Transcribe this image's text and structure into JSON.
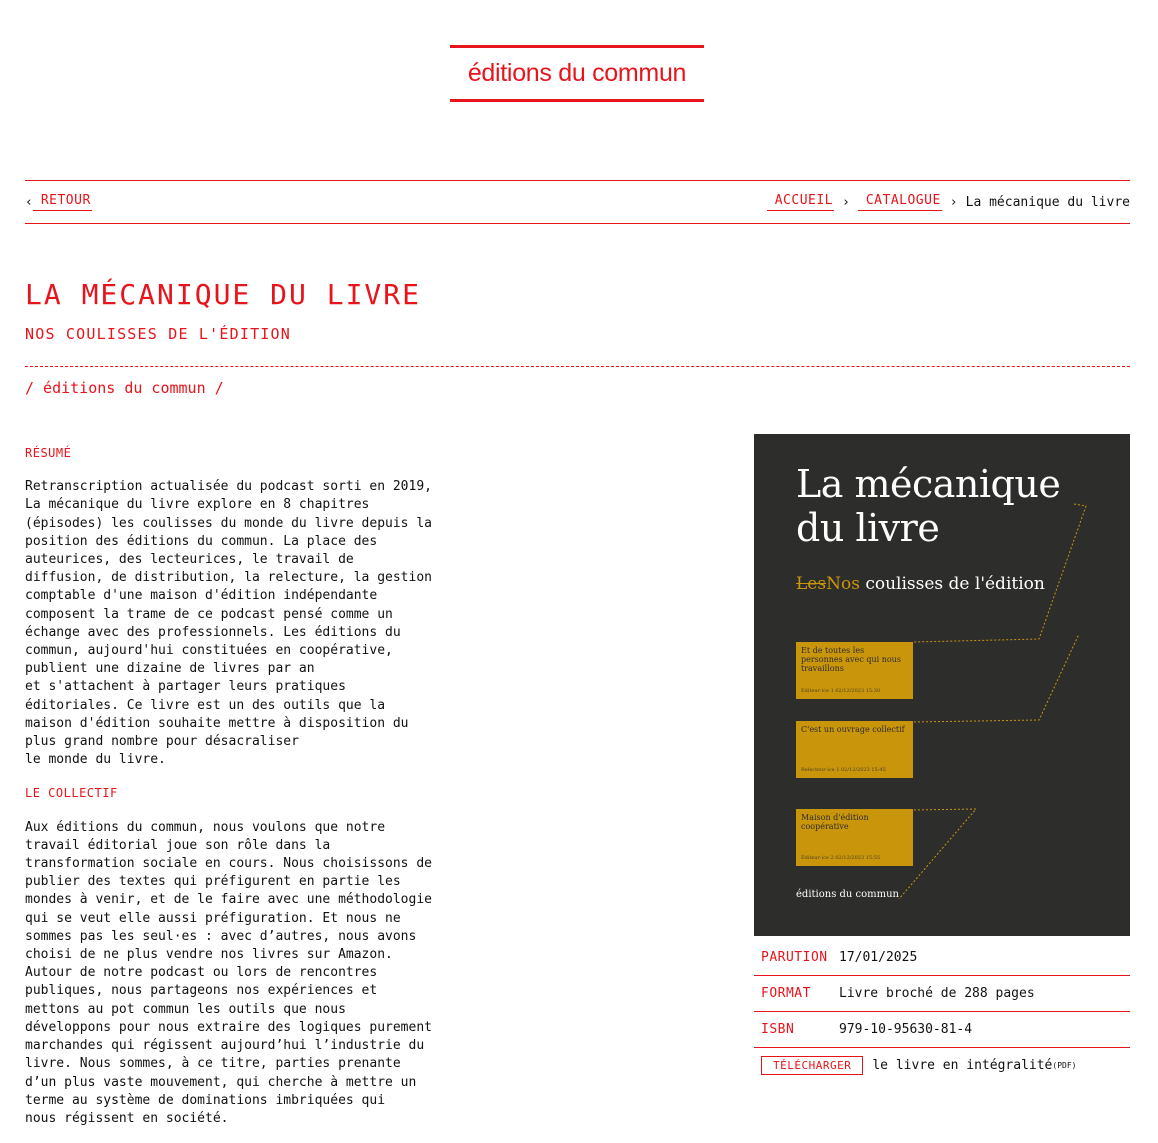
{
  "brand": {
    "logo": "éditions du commun"
  },
  "nav": {
    "back_arrow": "‹",
    "back_label": "RETOUR",
    "breadcrumb": [
      {
        "label": "ACCUEIL"
      },
      {
        "label": "CATALOGUE"
      }
    ],
    "separator": "›",
    "current": "La mécanique du livre"
  },
  "book": {
    "title": "LA MÉCANIQUE DU LIVRE",
    "subtitle": "NOS COULISSES DE L'ÉDITION",
    "publisher_line": "/ éditions du commun /"
  },
  "sections": {
    "resume_heading": "RÉSUMÉ",
    "resume_text": "Retranscription actualisée du podcast sorti en 2019,\nLa mécanique du livre explore en 8 chapitres\n(épisodes) les coulisses du monde du livre depuis la\nposition des éditions du commun. La place des\nauteurices, des lecteurices, le travail de\ndiffusion, de distribution, la relecture, la gestion\ncomptable d'une maison d'édition indépendante\ncomposent la trame de ce podcast pensé comme un\néchange avec des professionnels. Les éditions du\ncommun, aujourd'hui constituées en coopérative,\npublient une dizaine de livres par an\net s'attachent à partager leurs pratiques\néditoriales. Ce livre est un des outils que la\nmaison d'édition souhaite mettre à disposition du\nplus grand nombre pour désacraliser\nle monde du livre.",
    "collectif_heading": "LE COLLECTIF",
    "collectif_text": "Aux éditions du commun, nous voulons que notre\ntravail éditorial joue son rôle dans la\ntransformation sociale en cours. Nous choisissons de\npublier des textes qui préfigurent en partie les\nmondes à venir, et de le faire avec une méthodologie\nqui se veut elle aussi préfiguration. Et nous ne\nsommes pas les seul·es : avec d’autres, nous avons\nchoisi de ne plus vendre nos livres sur Amazon.\nAutour de notre podcast ou lors de rencontres\npubliques, nous partageons nos expériences et\nmettons au pot commun les outils que nous\ndéveloppons pour nous extraire des logiques purement\nmarchandes qui régissent aujourd’hui l’industrie du\nlivre. Nous sommes, à ce titre, parties prenante\nd’un plus vaste mouvement, qui cherche à mettre un\nterme au système de dominations imbriquées qui\nnous régissent en société."
  },
  "cover": {
    "title_line1": "La mécanique",
    "title_line2": "du livre",
    "sub_strike": "Les",
    "sub_nos": "Nos",
    "sub_rest": " coulisses de l'édition",
    "cards": [
      {
        "text": "Et de toutes les personnes avec qui nous travaillons",
        "small": "Éditeur·ice 1\n02/12/2023 15:30"
      },
      {
        "text": "C'est un ouvrage collectif",
        "small": "Relecteur·ice 1\n02/12/2023 15:45"
      },
      {
        "text": "Maison d'édition coopérative",
        "small": "Éditeur·ice 2\n02/12/2023 15:55"
      }
    ],
    "footer": "éditions du commun"
  },
  "meta": {
    "parution_label": "PARUTION",
    "parution_value": "17/01/2025",
    "format_label": "FORMAT",
    "format_value": "Livre broché de 288 pages",
    "isbn_label": "ISBN",
    "isbn_value": "979-10-95630-81-4",
    "download_label": "TÉLÉCHARGER",
    "download_text": "le livre en intégralité",
    "download_format": "(PDF)"
  },
  "colors": {
    "accent": "#e8141b",
    "cover_bg": "#2d2d2b",
    "cover_gold": "#c9950b"
  }
}
